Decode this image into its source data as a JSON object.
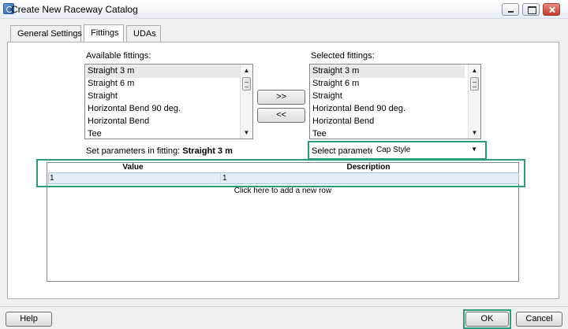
{
  "window": {
    "title": "Create New Raceway Catalog"
  },
  "tabs": [
    {
      "label": "General Settings"
    },
    {
      "label": "Fittings"
    },
    {
      "label": "UDAs"
    }
  ],
  "available": {
    "label": "Available fittings:",
    "items": [
      "Straight 3 m",
      "Straight 6 m",
      "Straight",
      "Horizontal Bend 90 deg.",
      "Horizontal Bend",
      "Tee"
    ]
  },
  "selected": {
    "label": "Selected fittings:",
    "items": [
      "Straight 3 m",
      "Straight 6 m",
      "Straight",
      "Horizontal Bend 90 deg.",
      "Horizontal Bend",
      "Tee"
    ]
  },
  "buttons": {
    "add": ">>",
    "remove": "<<",
    "help": "Help",
    "ok": "OK",
    "cancel": "Cancel"
  },
  "params": {
    "label": "Set parameters in fitting:",
    "fitting": "Straight 3 m",
    "select_label": "Select parameter:",
    "select_value": "Cap Style"
  },
  "grid": {
    "headers": [
      "Value",
      "Description"
    ],
    "rows": [
      [
        "1",
        "1"
      ]
    ],
    "add_row_text": "Click here to add a new row"
  },
  "colors": {
    "highlight": "#2a9d7f",
    "selected_item": "#e8e8e8",
    "row_bg": "#e3edf8"
  }
}
